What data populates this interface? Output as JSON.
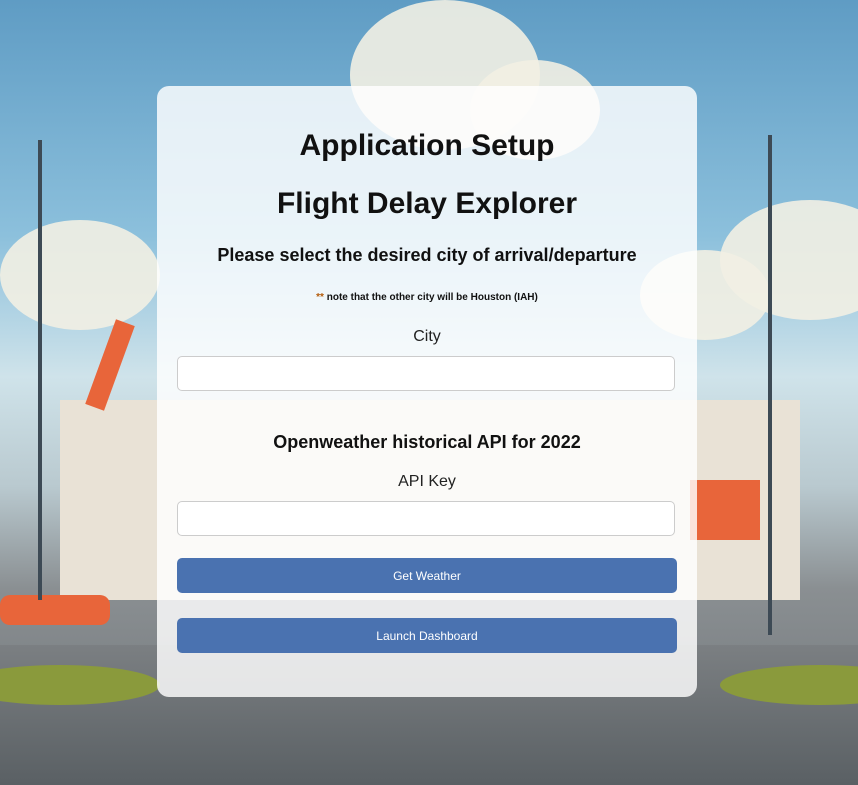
{
  "setup": {
    "title": "Application Setup",
    "app_name": "Flight Delay Explorer",
    "instruction": "Please select the desired city of arrival/departure",
    "note_marker": "**",
    "note": " note that the other city will be Houston (IAH)",
    "city_label": "City",
    "city_value": "",
    "api_heading": "Openweather historical API for 2022",
    "api_key_label": "API Key",
    "api_key_value": "",
    "get_weather_label": "Get Weather",
    "launch_dashboard_label": "Launch Dashboard"
  },
  "colors": {
    "button": "#4a72b0",
    "note_marker": "#b45b0a"
  }
}
